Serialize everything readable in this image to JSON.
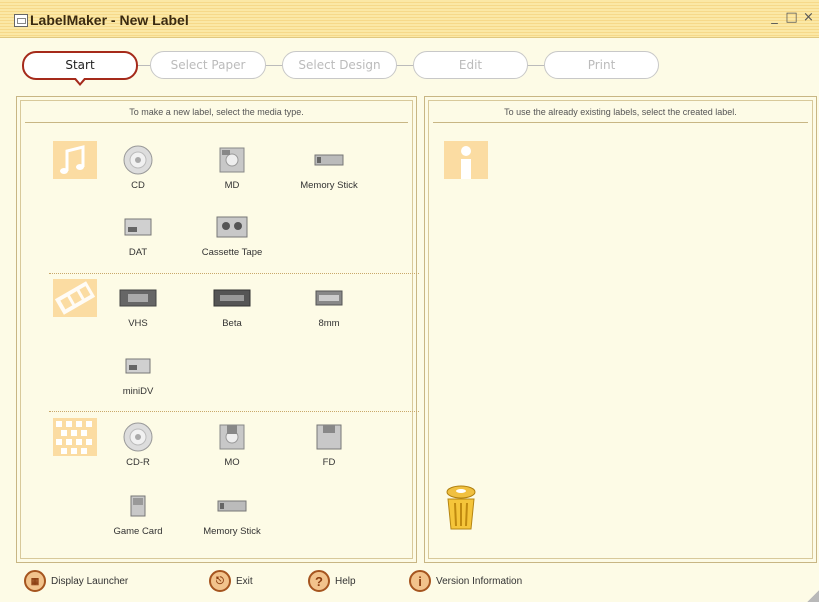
{
  "window": {
    "title": "LabelMaker - New Label",
    "controls": [
      "_",
      "□",
      "×"
    ]
  },
  "steps": [
    {
      "label": "Start",
      "active": true
    },
    {
      "label": "Select Paper",
      "active": false
    },
    {
      "label": "Select Design",
      "active": false
    },
    {
      "label": "Edit",
      "active": false
    },
    {
      "label": "Print",
      "active": false
    }
  ],
  "left_panel": {
    "header": "To make a new label, select the media type.",
    "groups": [
      {
        "category_icon": "music-icon",
        "items": [
          {
            "label": "CD",
            "icon": "cd-icon"
          },
          {
            "label": "MD",
            "icon": "md-icon"
          },
          {
            "label": "Memory Stick",
            "icon": "memory-stick-icon"
          },
          {
            "label": "DAT",
            "icon": "dat-icon"
          },
          {
            "label": "Cassette Tape",
            "icon": "cassette-tape-icon"
          }
        ]
      },
      {
        "category_icon": "film-icon",
        "items": [
          {
            "label": "VHS",
            "icon": "vhs-icon"
          },
          {
            "label": "Beta",
            "icon": "beta-icon"
          },
          {
            "label": "8mm",
            "icon": "8mm-icon"
          },
          {
            "label": "miniDV",
            "icon": "minidv-icon"
          }
        ]
      },
      {
        "category_icon": "data-icon",
        "items": [
          {
            "label": "CD-R",
            "icon": "cdr-icon"
          },
          {
            "label": "MO",
            "icon": "mo-icon"
          },
          {
            "label": "FD",
            "icon": "fd-icon"
          },
          {
            "label": "Game Card",
            "icon": "game-card-icon"
          },
          {
            "label": "Memory Stick",
            "icon": "memory-stick-icon"
          }
        ]
      }
    ]
  },
  "right_panel": {
    "header": "To use the already existing labels, select the created label."
  },
  "bottom_toolbar": {
    "display_launcher": "Display Launcher",
    "exit": "Exit",
    "help": "Help",
    "version_info": "Version Information"
  }
}
